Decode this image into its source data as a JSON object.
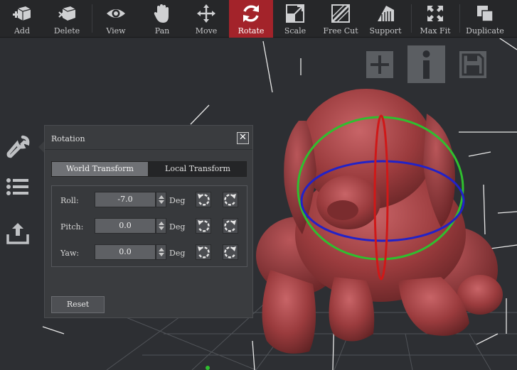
{
  "toolbar": {
    "items": [
      {
        "label": "Add",
        "icon": "add-cube-icon"
      },
      {
        "label": "Delete",
        "icon": "delete-cube-icon"
      },
      {
        "label": "View",
        "icon": "eye-icon"
      },
      {
        "label": "Pan",
        "icon": "hand-icon"
      },
      {
        "label": "Move",
        "icon": "move-arrows-icon"
      },
      {
        "label": "Rotate",
        "icon": "rotate-icon"
      },
      {
        "label": "Scale",
        "icon": "scale-icon"
      },
      {
        "label": "Free Cut",
        "icon": "free-cut-icon"
      },
      {
        "label": "Support",
        "icon": "support-icon"
      },
      {
        "label": "Max Fit",
        "icon": "max-fit-icon"
      },
      {
        "label": "Duplicate",
        "icon": "duplicate-icon"
      }
    ],
    "active": "Rotate",
    "active_color": "#a3232a"
  },
  "side_icons": [
    "wrench-icon",
    "list-icon",
    "upload-icon"
  ],
  "view_icons": [
    "plus-icon",
    "info-icon",
    "save-icon"
  ],
  "rotation_panel": {
    "title": "Rotation",
    "close_label": "✕",
    "tabs": {
      "world": "World Transform",
      "local": "Local Transform"
    },
    "active_tab": "World Transform",
    "fields": [
      {
        "label": "Roll:",
        "value": "-7.0",
        "unit": "Deg"
      },
      {
        "label": "Pitch:",
        "value": "0.0",
        "unit": "Deg"
      },
      {
        "label": "Yaw:",
        "value": "0.0",
        "unit": "Deg"
      }
    ],
    "reset_label": "Reset"
  },
  "colors": {
    "model": "#9a3b3d",
    "ring_green": "#2fbf2f",
    "ring_blue": "#2222c8",
    "ring_red": "#d01818"
  }
}
